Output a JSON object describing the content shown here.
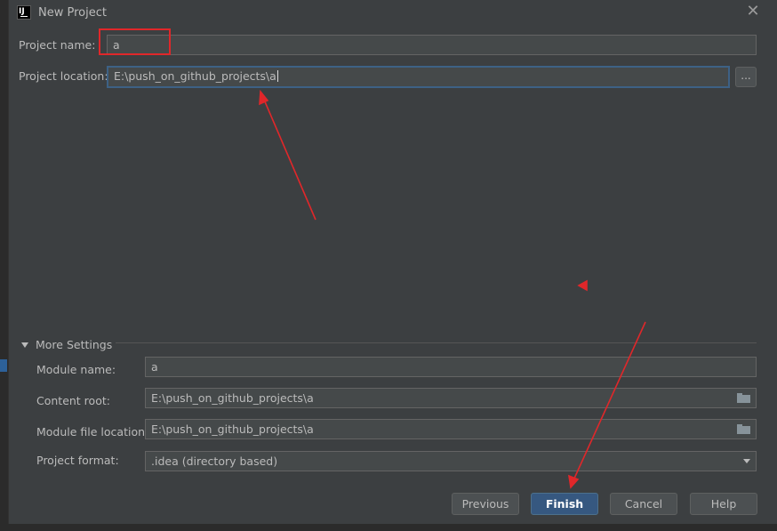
{
  "dialog": {
    "title": "New Project",
    "project_name_label": "Project name:",
    "project_name_value": "a",
    "project_location_label": "Project location:",
    "project_location_value": "E:\\push_on_github_projects\\a",
    "browse_label": "...",
    "more_settings_label": "More Settings",
    "module_name_label": "Module name:",
    "module_name_value": "a",
    "content_root_label": "Content root:",
    "content_root_value": "E:\\push_on_github_projects\\a",
    "module_file_location_label": "Module file location:",
    "module_file_location_value": "E:\\push_on_github_projects\\a",
    "project_format_label": "Project format:",
    "project_format_value": ".idea (directory based)",
    "buttons": {
      "previous": "Previous",
      "finish": "Finish",
      "cancel": "Cancel",
      "help": "Help"
    }
  },
  "colors": {
    "annotation": "#e0272a",
    "accent": "#365880"
  }
}
